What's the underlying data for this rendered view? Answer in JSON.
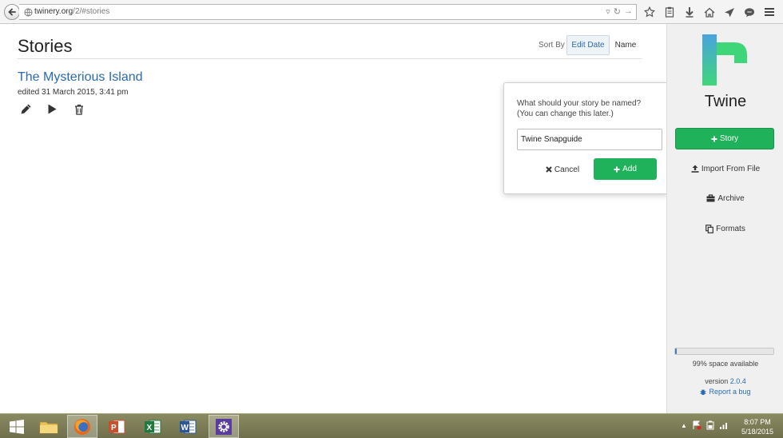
{
  "browser": {
    "url_host": "twinery.org",
    "url_path": "/2/#stories"
  },
  "main": {
    "title": "Stories",
    "sort_label": "Sort By",
    "sort_options": [
      "Edit Date",
      "Name"
    ],
    "stories": [
      {
        "name": "The Mysterious Island",
        "edited": "edited 31 March 2015, 3:41 pm"
      }
    ]
  },
  "popover": {
    "prompt_line1": "What should your story be named?",
    "prompt_line2": "(You can change this later.)",
    "input_value": "Twine Snapguide",
    "cancel_label": "Cancel",
    "add_label": "Add"
  },
  "sidebar": {
    "app_name": "Twine",
    "story_button": "Story",
    "import_label": "Import From File",
    "archive_label": "Archive",
    "formats_label": "Formats",
    "storage_used": 0.01,
    "storage_text": "99% space available",
    "version_label": "version",
    "version_number": "2.0.4",
    "bug_label": "Report a bug"
  },
  "colors": {
    "accent_green": "#1fb25a",
    "link_blue": "#2a6ab0",
    "logo_green": "#3fd67a",
    "logo_blue": "#4aa3df"
  },
  "taskbar": {
    "apps": [
      "windows-start",
      "file-explorer",
      "firefox",
      "powerpoint",
      "excel",
      "word",
      "settings"
    ],
    "time": "8:07 PM",
    "date": "5/18/2015"
  }
}
